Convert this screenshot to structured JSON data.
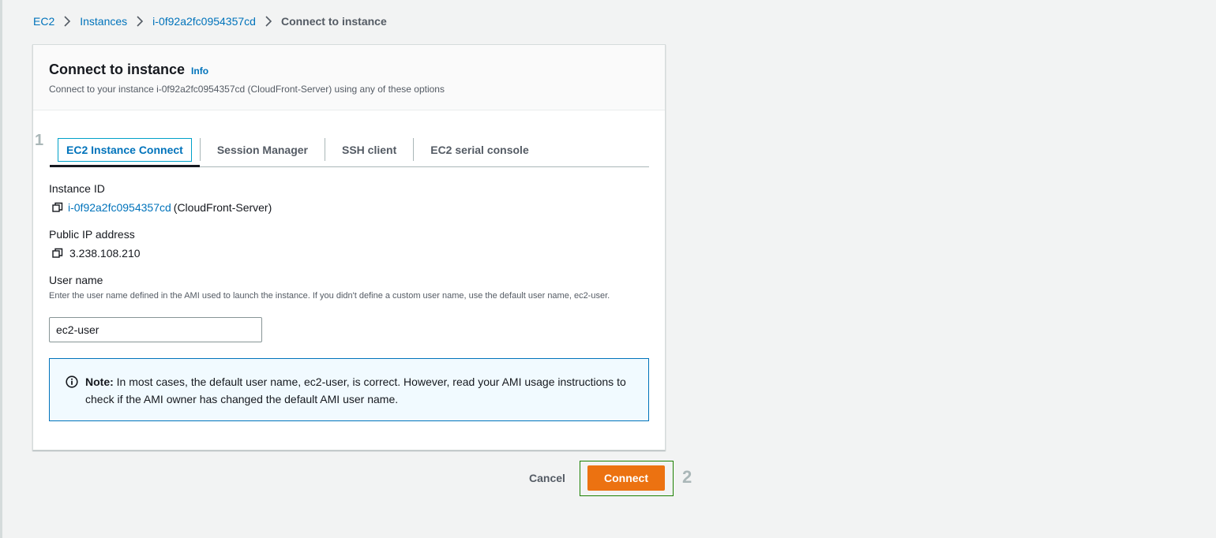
{
  "breadcrumb": {
    "items": [
      "EC2",
      "Instances",
      "i-0f92a2fc0954357cd"
    ],
    "current": "Connect to instance"
  },
  "panel": {
    "title": "Connect to instance",
    "info_label": "Info",
    "description": "Connect to your instance i-0f92a2fc0954357cd (CloudFront-Server) using any of these options"
  },
  "annotations": {
    "step1": "1",
    "step2": "2"
  },
  "tabs": [
    {
      "label": "EC2 Instance Connect",
      "active": true
    },
    {
      "label": "Session Manager",
      "active": false
    },
    {
      "label": "SSH client",
      "active": false
    },
    {
      "label": "EC2 serial console",
      "active": false
    }
  ],
  "instance": {
    "id_label": "Instance ID",
    "id_value": "i-0f92a2fc0954357cd",
    "name_suffix": "(CloudFront-Server)",
    "ip_label": "Public IP address",
    "ip_value": "3.238.108.210"
  },
  "username": {
    "label": "User name",
    "help": "Enter the user name defined in the AMI used to launch the instance. If you didn't define a custom user name, use the default user name, ec2-user.",
    "value": "ec2-user"
  },
  "note": {
    "bold": "Note:",
    "text": " In most cases, the default user name, ec2-user, is correct. However, read your AMI usage instructions to check if the AMI owner has changed the default AMI user name."
  },
  "actions": {
    "cancel": "Cancel",
    "connect": "Connect"
  },
  "colors": {
    "accent": "#0073bb",
    "primary_button": "#ec7211",
    "note_bg": "#f1faff"
  }
}
